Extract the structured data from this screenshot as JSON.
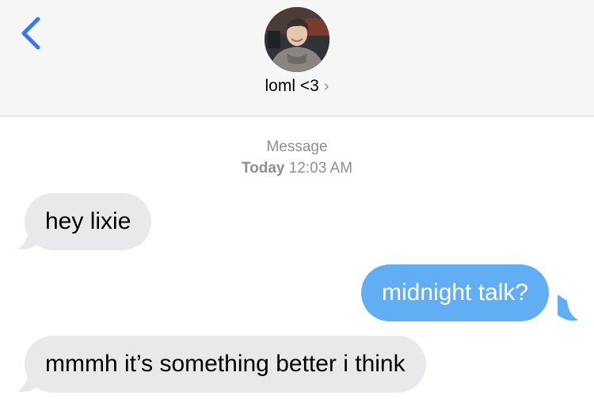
{
  "header": {
    "contact_name": "loml <3",
    "chevron": "›",
    "back_icon": "chevron-left-icon",
    "accent_color": "#3478f6"
  },
  "thread": {
    "service_label": "Message",
    "day_label": "Today",
    "time_label": "12:03 AM"
  },
  "messages": [
    {
      "direction": "incoming",
      "text": "hey lixie"
    },
    {
      "direction": "outgoing",
      "text": "midnight talk?"
    },
    {
      "direction": "incoming",
      "text": "mmmh it’s something better i think"
    }
  ],
  "colors": {
    "incoming_bubble": "#e9e9eb",
    "outgoing_bubble": "#61aef5",
    "header_bg": "#f6f6f6",
    "meta_text": "#8e8e93"
  }
}
